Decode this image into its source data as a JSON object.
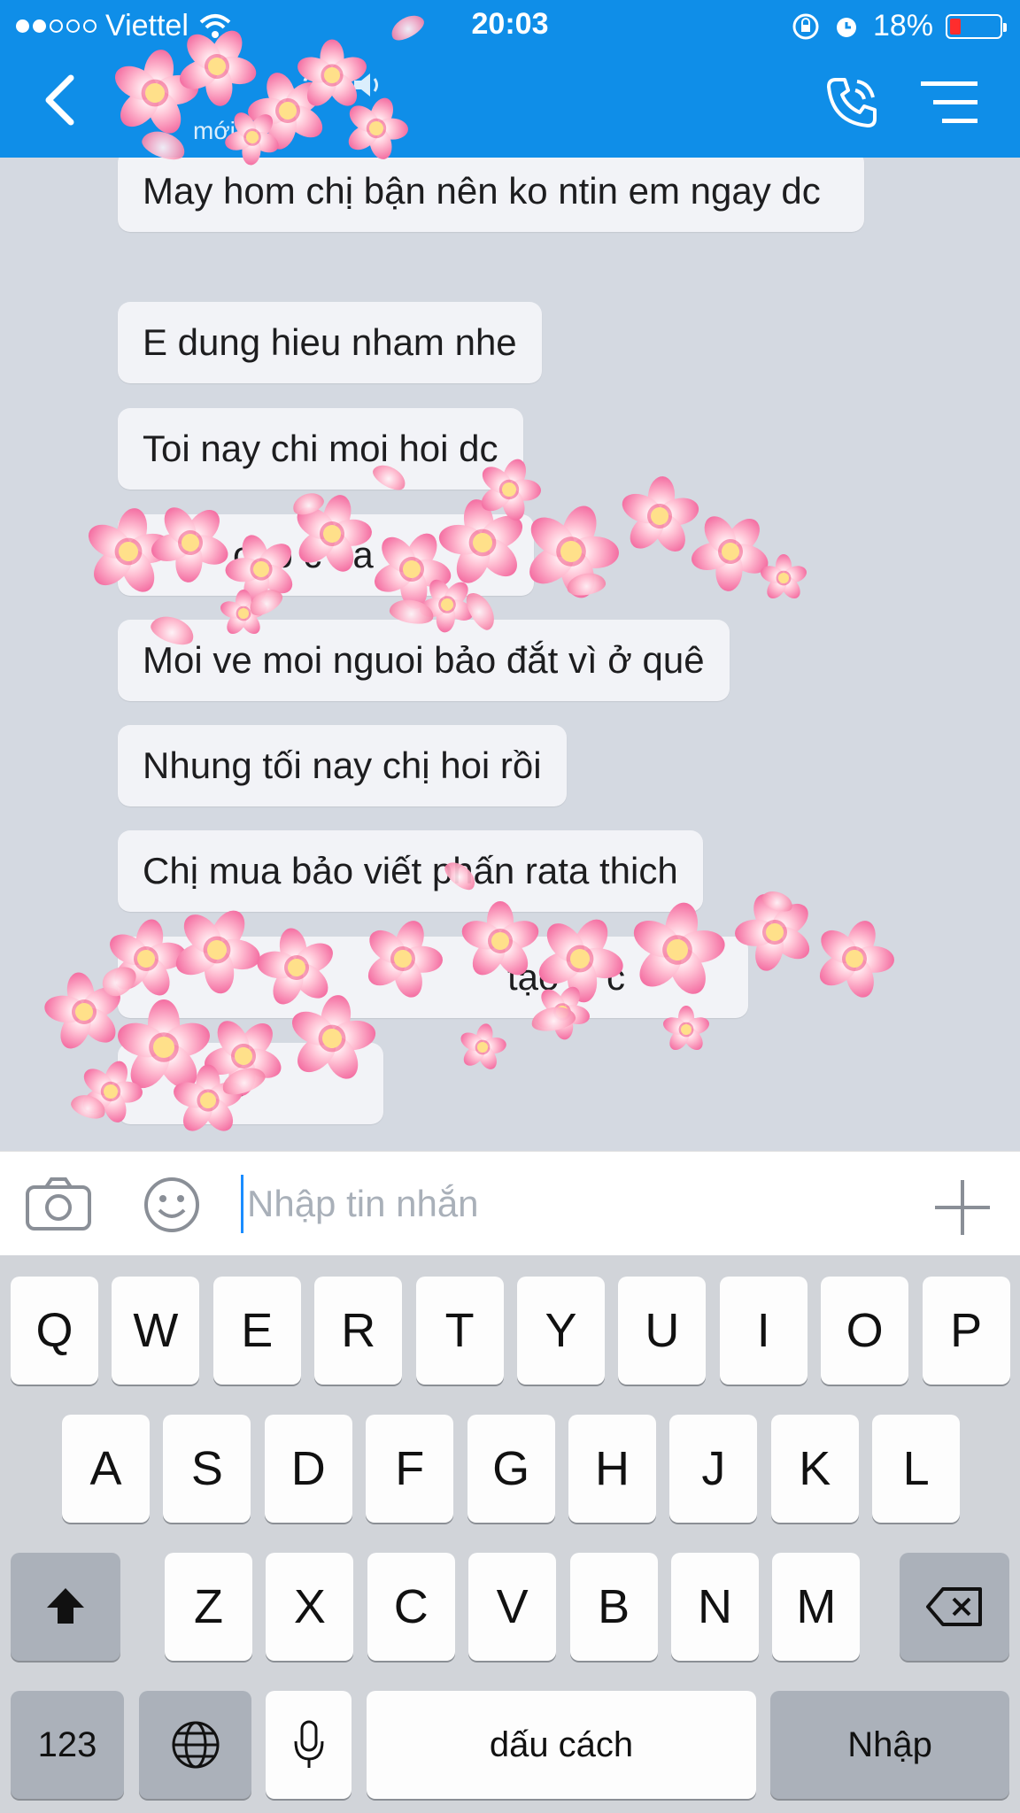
{
  "status_bar": {
    "carrier": "Viettel",
    "time": "20:03",
    "battery": "18%",
    "battery_level": 0.18
  },
  "header": {
    "title": "an",
    "subtitle": "mới",
    "icons": [
      "back-icon",
      "speaker-icon",
      "call-icon",
      "menu-icon"
    ]
  },
  "messages": [
    {
      "text": "May hom chị bận nên ko ntin em ngay dc"
    },
    {
      "text": "E dung hieu nham nhe"
    },
    {
      "text": "Toi nay chi moi hoi dc"
    },
    {
      "text": "oi p c đa"
    },
    {
      "text": "Moi ve moi nguoi bảo đắt vì ở quê"
    },
    {
      "text": "Nhung tối nay chị hoi rồi"
    },
    {
      "text": "Chị mua bảo viết phấn rata thich"
    },
    {
      "text": "tạo C c"
    },
    {
      "text": "t"
    }
  ],
  "input": {
    "placeholder": "Nhập tin nhắn",
    "value": ""
  },
  "keyboard": {
    "row1": [
      "Q",
      "W",
      "E",
      "R",
      "T",
      "Y",
      "U",
      "I",
      "O",
      "P"
    ],
    "row2": [
      "A",
      "S",
      "D",
      "F",
      "G",
      "H",
      "J",
      "K",
      "L"
    ],
    "row3": [
      "Z",
      "X",
      "C",
      "V",
      "B",
      "N",
      "M"
    ],
    "numbers_key": "123",
    "space_key": "dấu cách",
    "return_key": "Nhập"
  },
  "colors": {
    "header_bg": "#0f8ee8",
    "chat_bg": "#d4d9e1",
    "bubble_bg": "#f2f3f7",
    "cursor": "#1a8cff"
  }
}
